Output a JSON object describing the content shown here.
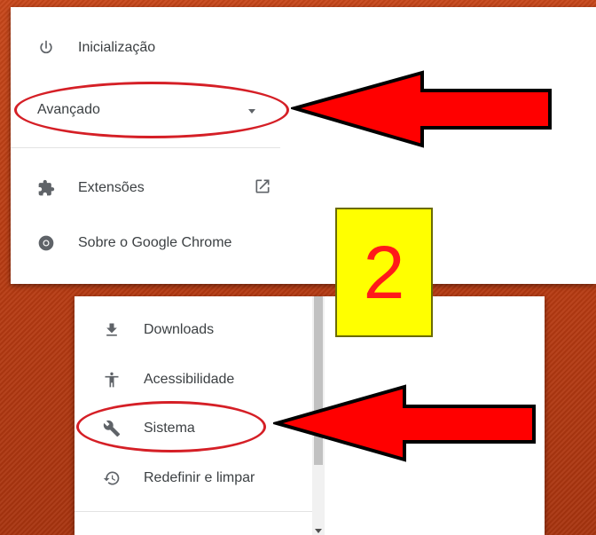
{
  "panel_top": {
    "items": [
      {
        "label": "Inicialização",
        "icon": "power-icon"
      },
      {
        "label": "Avançado",
        "icon": "chevron-down-icon"
      },
      {
        "label": "Extensões",
        "icon": "puzzle-icon",
        "trailing_icon": "open-in-new-icon"
      },
      {
        "label": "Sobre o Google Chrome",
        "icon": "chrome-icon"
      }
    ]
  },
  "panel_bottom": {
    "items": [
      {
        "label": "Downloads",
        "icon": "download-icon"
      },
      {
        "label": "Acessibilidade",
        "icon": "accessibility-icon"
      },
      {
        "label": "Sistema",
        "icon": "wrench-icon"
      },
      {
        "label": "Redefinir e limpar",
        "icon": "restore-icon"
      }
    ]
  },
  "step_badge": {
    "number": "2"
  },
  "colors": {
    "background": "#c7471a",
    "highlight_oval": "#d51f26",
    "arrow_fill": "#ff0000",
    "badge_fill": "#ffff00",
    "badge_text": "#ff1a1a"
  }
}
